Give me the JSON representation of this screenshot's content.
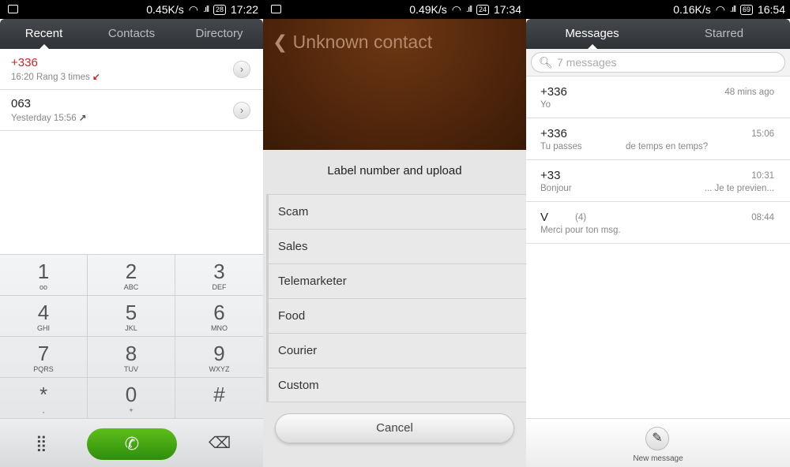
{
  "dialer": {
    "status": {
      "speed": "0.45K/s",
      "battery": "28",
      "time": "17:22"
    },
    "tabs": [
      "Recent",
      "Contacts",
      "Directory"
    ],
    "calls": [
      {
        "number": "+336",
        "detail": "16:20 Rang 3 times",
        "type": "missed",
        "color": "#c62828"
      },
      {
        "number": "063",
        "detail": "Yesterday 15:56",
        "type": "outgoing"
      }
    ],
    "keys": [
      {
        "d": "1",
        "l": "oo"
      },
      {
        "d": "2",
        "l": "ABC"
      },
      {
        "d": "3",
        "l": "DEF"
      },
      {
        "d": "4",
        "l": "GHI"
      },
      {
        "d": "5",
        "l": "JKL"
      },
      {
        "d": "6",
        "l": "MNO"
      },
      {
        "d": "7",
        "l": "PQRS"
      },
      {
        "d": "8",
        "l": "TUV"
      },
      {
        "d": "9",
        "l": "WXYZ"
      },
      {
        "d": "*",
        "l": ","
      },
      {
        "d": "0",
        "l": "+"
      },
      {
        "d": "#",
        "l": ""
      }
    ],
    "call_color": "#3fa511"
  },
  "label": {
    "status": {
      "speed": "0.49K/s",
      "battery": "24",
      "time": "17:34"
    },
    "title": "Unknown contact",
    "dialog_title": "Label number and upload",
    "options": [
      "Scam",
      "Sales",
      "Telemarketer",
      "Food",
      "Courier",
      "Custom"
    ],
    "cancel": "Cancel"
  },
  "messages": {
    "status": {
      "speed": "0.16K/s",
      "battery": "69",
      "time": "16:54"
    },
    "tabs": [
      "Messages",
      "Starred"
    ],
    "search_placeholder": "7 messages",
    "items": [
      {
        "name": "+336",
        "time": "48 mins ago",
        "preview": "Yo",
        "preview2": ""
      },
      {
        "name": "+336",
        "time": "15:06",
        "preview": "Tu passes",
        "preview2": "de temps en temps?"
      },
      {
        "name": "+33",
        "time": "10:31",
        "preview": "Bonjour",
        "preview2": "... Je te previen..."
      },
      {
        "name": "V",
        "count": "(4)",
        "time": "08:44",
        "preview": "Merci pour ton msg.",
        "preview2": ""
      }
    ],
    "new_message": "New message"
  }
}
